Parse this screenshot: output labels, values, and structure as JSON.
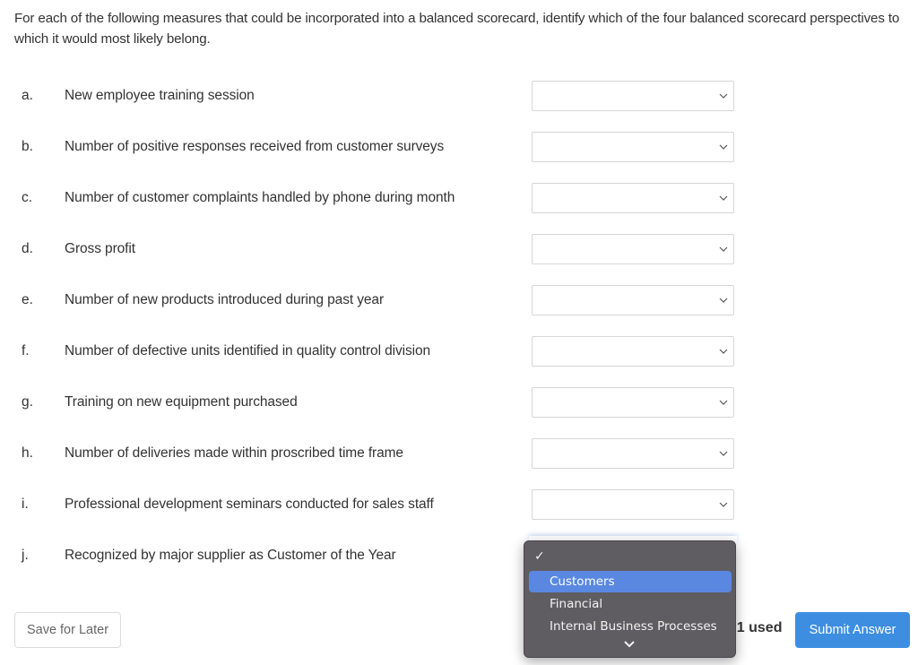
{
  "prompt": "For each of the following measures that could be incorporated into a balanced scorecard, identify which of the four balanced scorecard perspectives to which it would most likely belong.",
  "items": [
    {
      "letter": "a.",
      "measure": "New employee training session",
      "selected": ""
    },
    {
      "letter": "b.",
      "measure": "Number of positive responses received from customer surveys",
      "selected": ""
    },
    {
      "letter": "c.",
      "measure": "Number of customer complaints handled by phone during month",
      "selected": ""
    },
    {
      "letter": "d.",
      "measure": "Gross profit",
      "selected": ""
    },
    {
      "letter": "e.",
      "measure": "Number of new products introduced during past year",
      "selected": ""
    },
    {
      "letter": "f.",
      "measure": "Number of defective units identified in quality control division",
      "selected": ""
    },
    {
      "letter": "g.",
      "measure": "Training on new equipment purchased",
      "selected": ""
    },
    {
      "letter": "h.",
      "measure": "Number of deliveries made within proscribed time frame",
      "selected": ""
    },
    {
      "letter": "i.",
      "measure": "Professional development seminars conducted for sales staff",
      "selected": ""
    },
    {
      "letter": "j.",
      "measure": "Recognized by major supplier as Customer of the Year",
      "selected": ""
    }
  ],
  "dropdown": {
    "checkmark": "✓",
    "options": [
      "Customers",
      "Financial",
      "Internal Business Processes"
    ],
    "highlighted": "Customers",
    "more_icon": "chevron-down-icon"
  },
  "footer": {
    "save_label": "Save for Later",
    "attempts_text": "f 1 used",
    "submit_label": "Submit Answer"
  },
  "colors": {
    "submit_bg": "#3d8ee0",
    "dropdown_bg": "#5f5d61",
    "highlight_bg": "#5a88e0"
  }
}
